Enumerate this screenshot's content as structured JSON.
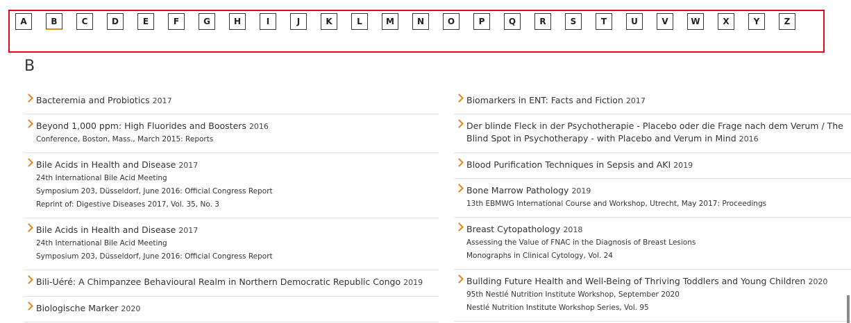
{
  "alphabet": [
    "A",
    "B",
    "C",
    "D",
    "E",
    "F",
    "G",
    "H",
    "I",
    "J",
    "K",
    "L",
    "M",
    "N",
    "O",
    "P",
    "Q",
    "R",
    "S",
    "T",
    "U",
    "V",
    "W",
    "X",
    "Y",
    "Z"
  ],
  "active_letter": "B",
  "section_letter": "B",
  "colors": {
    "accent": "#e8841a",
    "highlight_border": "#e30613"
  },
  "left_items": [
    {
      "title": "Bacteremia and Probiotics",
      "year": "2017",
      "subs": []
    },
    {
      "title": "Beyond 1,000 ppm: High Fluorides and Boosters",
      "year": "2016",
      "subs": [
        "Conference, Boston, Mass., March 2015: Reports"
      ]
    },
    {
      "title": "Bile Acids in Health and Disease",
      "year": "2017",
      "subs": [
        "24th International Bile Acid Meeting",
        "Symposium 203, Düsseldorf, June 2016: Official Congress Report",
        "Reprint of: Digestive Diseases 2017, Vol. 35, No. 3"
      ]
    },
    {
      "title": "Bile Acids in Health and Disease",
      "year": "2017",
      "subs": [
        "24th International Bile Acid Meeting",
        "Symposium 203, Düsseldorf, June 2016: Official Congress Report"
      ]
    },
    {
      "title": "Bili-Uéré: A Chimpanzee Behavioural Realm in Northern Democratic Republic Congo",
      "year": "2019",
      "subs": []
    },
    {
      "title": "Biologische Marker",
      "year": "2020",
      "subs": []
    }
  ],
  "right_items": [
    {
      "title": "Biomarkers in ENT: Facts and Fiction",
      "year": "2017",
      "subs": []
    },
    {
      "title": "Der blinde Fleck in der Psychotherapie - Placebo oder die Frage nach dem Verum / The Blind Spot in Psychotherapy - with Placebo and Verum in Mind",
      "year": "2016",
      "subs": []
    },
    {
      "title": "Blood Purification Techniques in Sepsis and AKI",
      "year": "2019",
      "subs": []
    },
    {
      "title": "Bone Marrow Pathology",
      "year": "2019",
      "subs": [
        "13th EBMWG International Course and Workshop, Utrecht, May 2017: Proceedings"
      ]
    },
    {
      "title": "Breast Cytopathology",
      "year": "2018",
      "subs": [
        "Assessing the Value of FNAC in the Diagnosis of Breast Lesions",
        "Monographs in Clinical Cytology, Vol. 24"
      ]
    },
    {
      "title": "Building Future Health and Well-Being of Thriving Toddlers and Young Children",
      "year": "2020",
      "subs": [
        "95th Nestlé Nutrition Institute Workshop, September 2020",
        "Nestlé Nutrition Institute Workshop Series, Vol. 95"
      ]
    }
  ]
}
